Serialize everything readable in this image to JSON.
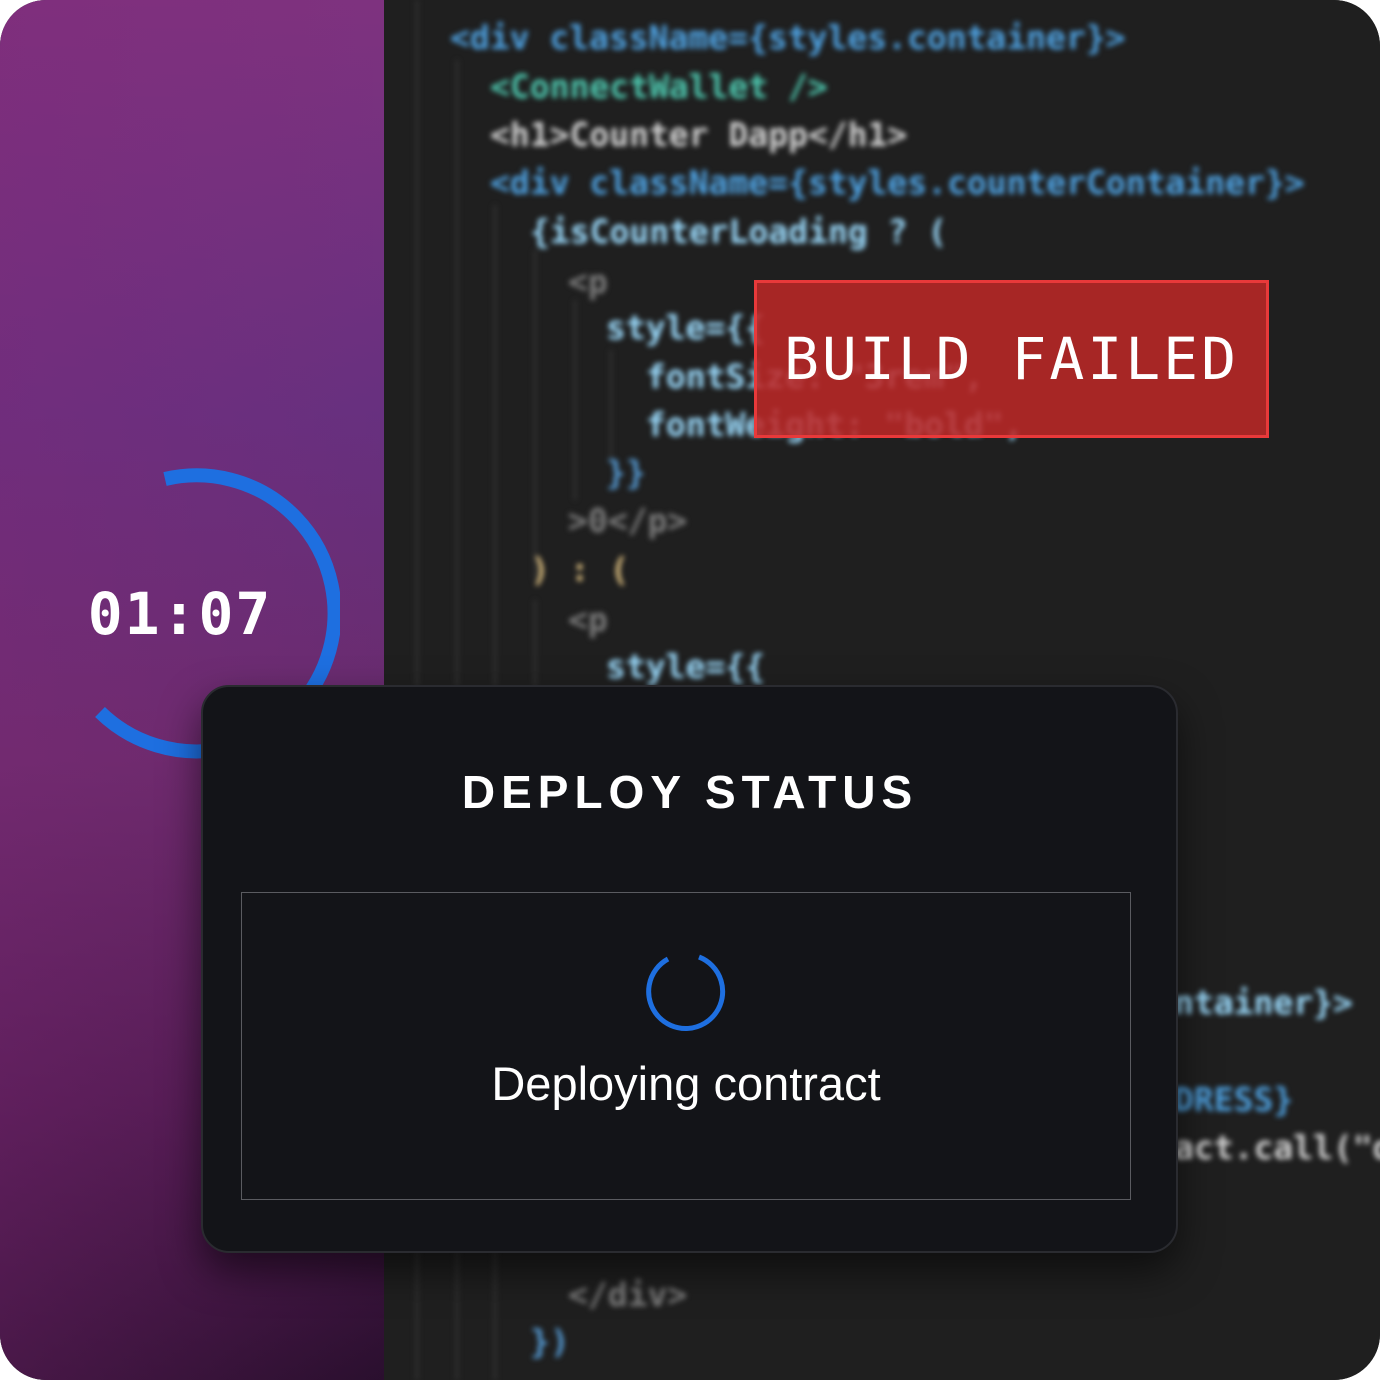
{
  "timer": {
    "value": "01:07",
    "ring_color": "#1e6fe0"
  },
  "build_banner": {
    "label": "BUILD FAILED",
    "background": "#be2826",
    "border": "#e8393a"
  },
  "deploy_status": {
    "title": "DEPLOY STATUS",
    "message": "Deploying contract",
    "spinner_color": "#1e6fe0"
  },
  "code_editor": {
    "lines": [
      "<div className={styles.container}>",
      "<ConnectWallet />",
      "<h1>Counter Dapp</h1>",
      "<div className={styles.counterContainer}>",
      "{isCounterLoading ? (",
      "<p",
      "style={{",
      "fontSize: \"3rem\",",
      "fontWeight: \"bold\",",
      "}}",
      ">0</p>",
      ") : (",
      "<p",
      "style={{",
      "ntainer}>",
      "DRESS}",
      "act.call(\"d",
      "</div>",
      "})"
    ]
  }
}
